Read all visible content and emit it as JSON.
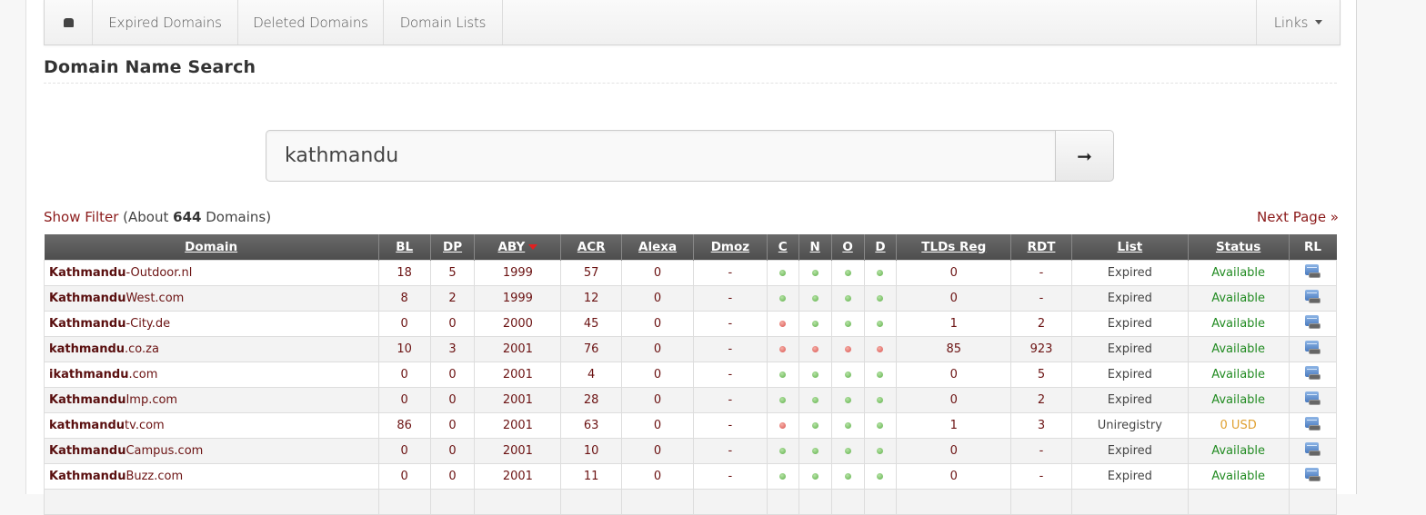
{
  "nav": {
    "home_icon": "home-icon",
    "items": [
      "Expired Domains",
      "Deleted Domains",
      "Domain Lists"
    ],
    "links_label": "Links"
  },
  "page_title": "Domain Name Search",
  "search": {
    "value": "kathmandu",
    "button_icon": "arrow-right-icon",
    "button_glyph": "➞"
  },
  "results": {
    "show_filter": "Show Filter",
    "about_prefix": "(About ",
    "count": "644",
    "about_suffix": " Domains)",
    "next_page": "Next Page »"
  },
  "table": {
    "columns": [
      "Domain",
      "BL",
      "DP",
      "ABY",
      "ACR",
      "Alexa",
      "Dmoz",
      "C",
      "N",
      "O",
      "D",
      "TLDs Reg",
      "RDT",
      "List",
      "Status",
      "RL"
    ],
    "sorted_column": "ABY",
    "sort_direction": "desc",
    "rows": [
      {
        "keyword": "Kathmandu",
        "rest": "-Outdoor.nl",
        "bl": "18",
        "dp": "5",
        "aby": "1999",
        "acr": "57",
        "alexa": "0",
        "dmoz": "-",
        "c": "green",
        "n": "green",
        "o": "green",
        "d": "green",
        "tlds": "0",
        "rdt": "-",
        "list": "Expired",
        "status": "Available",
        "status_type": "available"
      },
      {
        "keyword": "Kathmandu",
        "rest": "West.com",
        "bl": "8",
        "dp": "2",
        "aby": "1999",
        "acr": "12",
        "alexa": "0",
        "dmoz": "-",
        "c": "green",
        "n": "green",
        "o": "green",
        "d": "green",
        "tlds": "0",
        "rdt": "-",
        "list": "Expired",
        "status": "Available",
        "status_type": "available"
      },
      {
        "keyword": "Kathmandu",
        "rest": "-City.de",
        "bl": "0",
        "dp": "0",
        "aby": "2000",
        "acr": "45",
        "alexa": "0",
        "dmoz": "-",
        "c": "red",
        "n": "green",
        "o": "green",
        "d": "green",
        "tlds": "1",
        "rdt": "2",
        "list": "Expired",
        "status": "Available",
        "status_type": "available"
      },
      {
        "keyword": "kathmandu",
        "rest": ".co.za",
        "bl": "10",
        "dp": "3",
        "aby": "2001",
        "acr": "76",
        "alexa": "0",
        "dmoz": "-",
        "c": "red",
        "n": "red",
        "o": "red",
        "d": "red",
        "tlds": "85",
        "rdt": "923",
        "list": "Expired",
        "status": "Available",
        "status_type": "available"
      },
      {
        "keyword": "ikathmandu",
        "rest": ".com",
        "bl": "0",
        "dp": "0",
        "aby": "2001",
        "acr": "4",
        "alexa": "0",
        "dmoz": "-",
        "c": "green",
        "n": "green",
        "o": "green",
        "d": "green",
        "tlds": "0",
        "rdt": "5",
        "list": "Expired",
        "status": "Available",
        "status_type": "available"
      },
      {
        "keyword": "Kathmandu",
        "rest": "Imp.com",
        "bl": "0",
        "dp": "0",
        "aby": "2001",
        "acr": "28",
        "alexa": "0",
        "dmoz": "-",
        "c": "green",
        "n": "green",
        "o": "green",
        "d": "green",
        "tlds": "0",
        "rdt": "2",
        "list": "Expired",
        "status": "Available",
        "status_type": "available"
      },
      {
        "keyword": "kathmandu",
        "rest": "tv.com",
        "bl": "86",
        "dp": "0",
        "aby": "2001",
        "acr": "63",
        "alexa": "0",
        "dmoz": "-",
        "c": "red",
        "n": "green",
        "o": "green",
        "d": "green",
        "tlds": "1",
        "rdt": "3",
        "list": "Uniregistry",
        "status": "0 USD",
        "status_type": "price"
      },
      {
        "keyword": "Kathmandu",
        "rest": "Campus.com",
        "bl": "0",
        "dp": "0",
        "aby": "2001",
        "acr": "10",
        "alexa": "0",
        "dmoz": "-",
        "c": "green",
        "n": "green",
        "o": "green",
        "d": "green",
        "tlds": "0",
        "rdt": "-",
        "list": "Expired",
        "status": "Available",
        "status_type": "available"
      },
      {
        "keyword": "Kathmandu",
        "rest": "Buzz.com",
        "bl": "0",
        "dp": "0",
        "aby": "2001",
        "acr": "11",
        "alexa": "0",
        "dmoz": "-",
        "c": "green",
        "n": "green",
        "o": "green",
        "d": "green",
        "tlds": "0",
        "rdt": "-",
        "list": "Expired",
        "status": "Available",
        "status_type": "available"
      },
      {
        "keyword": "",
        "rest": "",
        "bl": "",
        "dp": "",
        "aby": "",
        "acr": "",
        "alexa": "",
        "dmoz": "",
        "c": "",
        "n": "",
        "o": "",
        "d": "",
        "tlds": "",
        "rdt": "",
        "list": "",
        "status": "",
        "status_type": ""
      }
    ]
  },
  "colors": {
    "link": "#8b1a1a",
    "available": "#228b22",
    "price": "#e0a030",
    "header_bg": "#555555"
  }
}
